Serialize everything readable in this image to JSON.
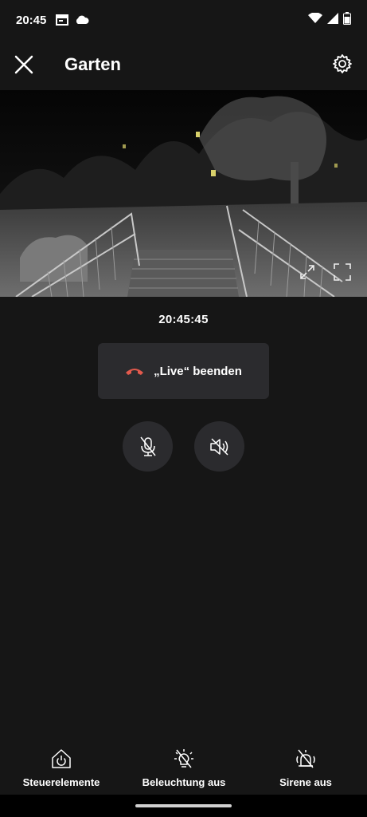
{
  "status_bar": {
    "time": "20:45",
    "icons": [
      "calendar-icon",
      "cloud-icon",
      "wifi-icon",
      "signal-icon",
      "battery-icon"
    ]
  },
  "app_bar": {
    "title": "Garten",
    "close_icon": "close-icon",
    "settings_icon": "gear-icon"
  },
  "camera": {
    "timestamp": "20:45:45",
    "icons": [
      "expand-icon",
      "fullscreen-icon"
    ]
  },
  "controls": {
    "end_live_label": "„Live“ beenden",
    "end_live_icon": "hang-up-icon",
    "end_live_icon_color": "#e35a4d",
    "mic_icon": "mic-muted-icon",
    "speaker_icon": "speaker-muted-icon"
  },
  "bottom_bar": {
    "items": [
      {
        "label": "Steuerelemente",
        "icon": "home-power-icon"
      },
      {
        "label": "Beleuchtung aus",
        "icon": "light-off-icon"
      },
      {
        "label": "Sirene aus",
        "icon": "siren-off-icon"
      }
    ]
  },
  "colors": {
    "background": "#161616",
    "button_bg": "#2b2b2e",
    "accent_red": "#e35a4d"
  }
}
